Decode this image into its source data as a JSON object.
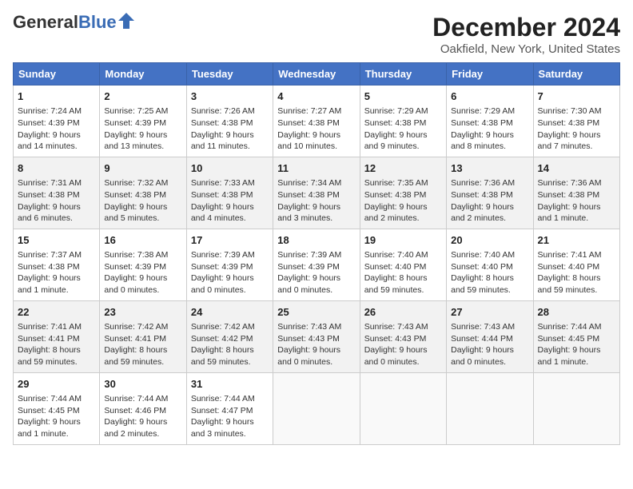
{
  "header": {
    "logo_general": "General",
    "logo_blue": "Blue",
    "title": "December 2024",
    "subtitle": "Oakfield, New York, United States"
  },
  "weekdays": [
    "Sunday",
    "Monday",
    "Tuesday",
    "Wednesday",
    "Thursday",
    "Friday",
    "Saturday"
  ],
  "weeks": [
    [
      {
        "day": "1",
        "info": "Sunrise: 7:24 AM\nSunset: 4:39 PM\nDaylight: 9 hours and 14 minutes."
      },
      {
        "day": "2",
        "info": "Sunrise: 7:25 AM\nSunset: 4:39 PM\nDaylight: 9 hours and 13 minutes."
      },
      {
        "day": "3",
        "info": "Sunrise: 7:26 AM\nSunset: 4:38 PM\nDaylight: 9 hours and 11 minutes."
      },
      {
        "day": "4",
        "info": "Sunrise: 7:27 AM\nSunset: 4:38 PM\nDaylight: 9 hours and 10 minutes."
      },
      {
        "day": "5",
        "info": "Sunrise: 7:29 AM\nSunset: 4:38 PM\nDaylight: 9 hours and 9 minutes."
      },
      {
        "day": "6",
        "info": "Sunrise: 7:29 AM\nSunset: 4:38 PM\nDaylight: 9 hours and 8 minutes."
      },
      {
        "day": "7",
        "info": "Sunrise: 7:30 AM\nSunset: 4:38 PM\nDaylight: 9 hours and 7 minutes."
      }
    ],
    [
      {
        "day": "8",
        "info": "Sunrise: 7:31 AM\nSunset: 4:38 PM\nDaylight: 9 hours and 6 minutes."
      },
      {
        "day": "9",
        "info": "Sunrise: 7:32 AM\nSunset: 4:38 PM\nDaylight: 9 hours and 5 minutes."
      },
      {
        "day": "10",
        "info": "Sunrise: 7:33 AM\nSunset: 4:38 PM\nDaylight: 9 hours and 4 minutes."
      },
      {
        "day": "11",
        "info": "Sunrise: 7:34 AM\nSunset: 4:38 PM\nDaylight: 9 hours and 3 minutes."
      },
      {
        "day": "12",
        "info": "Sunrise: 7:35 AM\nSunset: 4:38 PM\nDaylight: 9 hours and 2 minutes."
      },
      {
        "day": "13",
        "info": "Sunrise: 7:36 AM\nSunset: 4:38 PM\nDaylight: 9 hours and 2 minutes."
      },
      {
        "day": "14",
        "info": "Sunrise: 7:36 AM\nSunset: 4:38 PM\nDaylight: 9 hours and 1 minute."
      }
    ],
    [
      {
        "day": "15",
        "info": "Sunrise: 7:37 AM\nSunset: 4:38 PM\nDaylight: 9 hours and 1 minute."
      },
      {
        "day": "16",
        "info": "Sunrise: 7:38 AM\nSunset: 4:39 PM\nDaylight: 9 hours and 0 minutes."
      },
      {
        "day": "17",
        "info": "Sunrise: 7:39 AM\nSunset: 4:39 PM\nDaylight: 9 hours and 0 minutes."
      },
      {
        "day": "18",
        "info": "Sunrise: 7:39 AM\nSunset: 4:39 PM\nDaylight: 9 hours and 0 minutes."
      },
      {
        "day": "19",
        "info": "Sunrise: 7:40 AM\nSunset: 4:40 PM\nDaylight: 8 hours and 59 minutes."
      },
      {
        "day": "20",
        "info": "Sunrise: 7:40 AM\nSunset: 4:40 PM\nDaylight: 8 hours and 59 minutes."
      },
      {
        "day": "21",
        "info": "Sunrise: 7:41 AM\nSunset: 4:40 PM\nDaylight: 8 hours and 59 minutes."
      }
    ],
    [
      {
        "day": "22",
        "info": "Sunrise: 7:41 AM\nSunset: 4:41 PM\nDaylight: 8 hours and 59 minutes."
      },
      {
        "day": "23",
        "info": "Sunrise: 7:42 AM\nSunset: 4:41 PM\nDaylight: 8 hours and 59 minutes."
      },
      {
        "day": "24",
        "info": "Sunrise: 7:42 AM\nSunset: 4:42 PM\nDaylight: 8 hours and 59 minutes."
      },
      {
        "day": "25",
        "info": "Sunrise: 7:43 AM\nSunset: 4:43 PM\nDaylight: 9 hours and 0 minutes."
      },
      {
        "day": "26",
        "info": "Sunrise: 7:43 AM\nSunset: 4:43 PM\nDaylight: 9 hours and 0 minutes."
      },
      {
        "day": "27",
        "info": "Sunrise: 7:43 AM\nSunset: 4:44 PM\nDaylight: 9 hours and 0 minutes."
      },
      {
        "day": "28",
        "info": "Sunrise: 7:44 AM\nSunset: 4:45 PM\nDaylight: 9 hours and 1 minute."
      }
    ],
    [
      {
        "day": "29",
        "info": "Sunrise: 7:44 AM\nSunset: 4:45 PM\nDaylight: 9 hours and 1 minute."
      },
      {
        "day": "30",
        "info": "Sunrise: 7:44 AM\nSunset: 4:46 PM\nDaylight: 9 hours and 2 minutes."
      },
      {
        "day": "31",
        "info": "Sunrise: 7:44 AM\nSunset: 4:47 PM\nDaylight: 9 hours and 3 minutes."
      },
      null,
      null,
      null,
      null
    ]
  ]
}
